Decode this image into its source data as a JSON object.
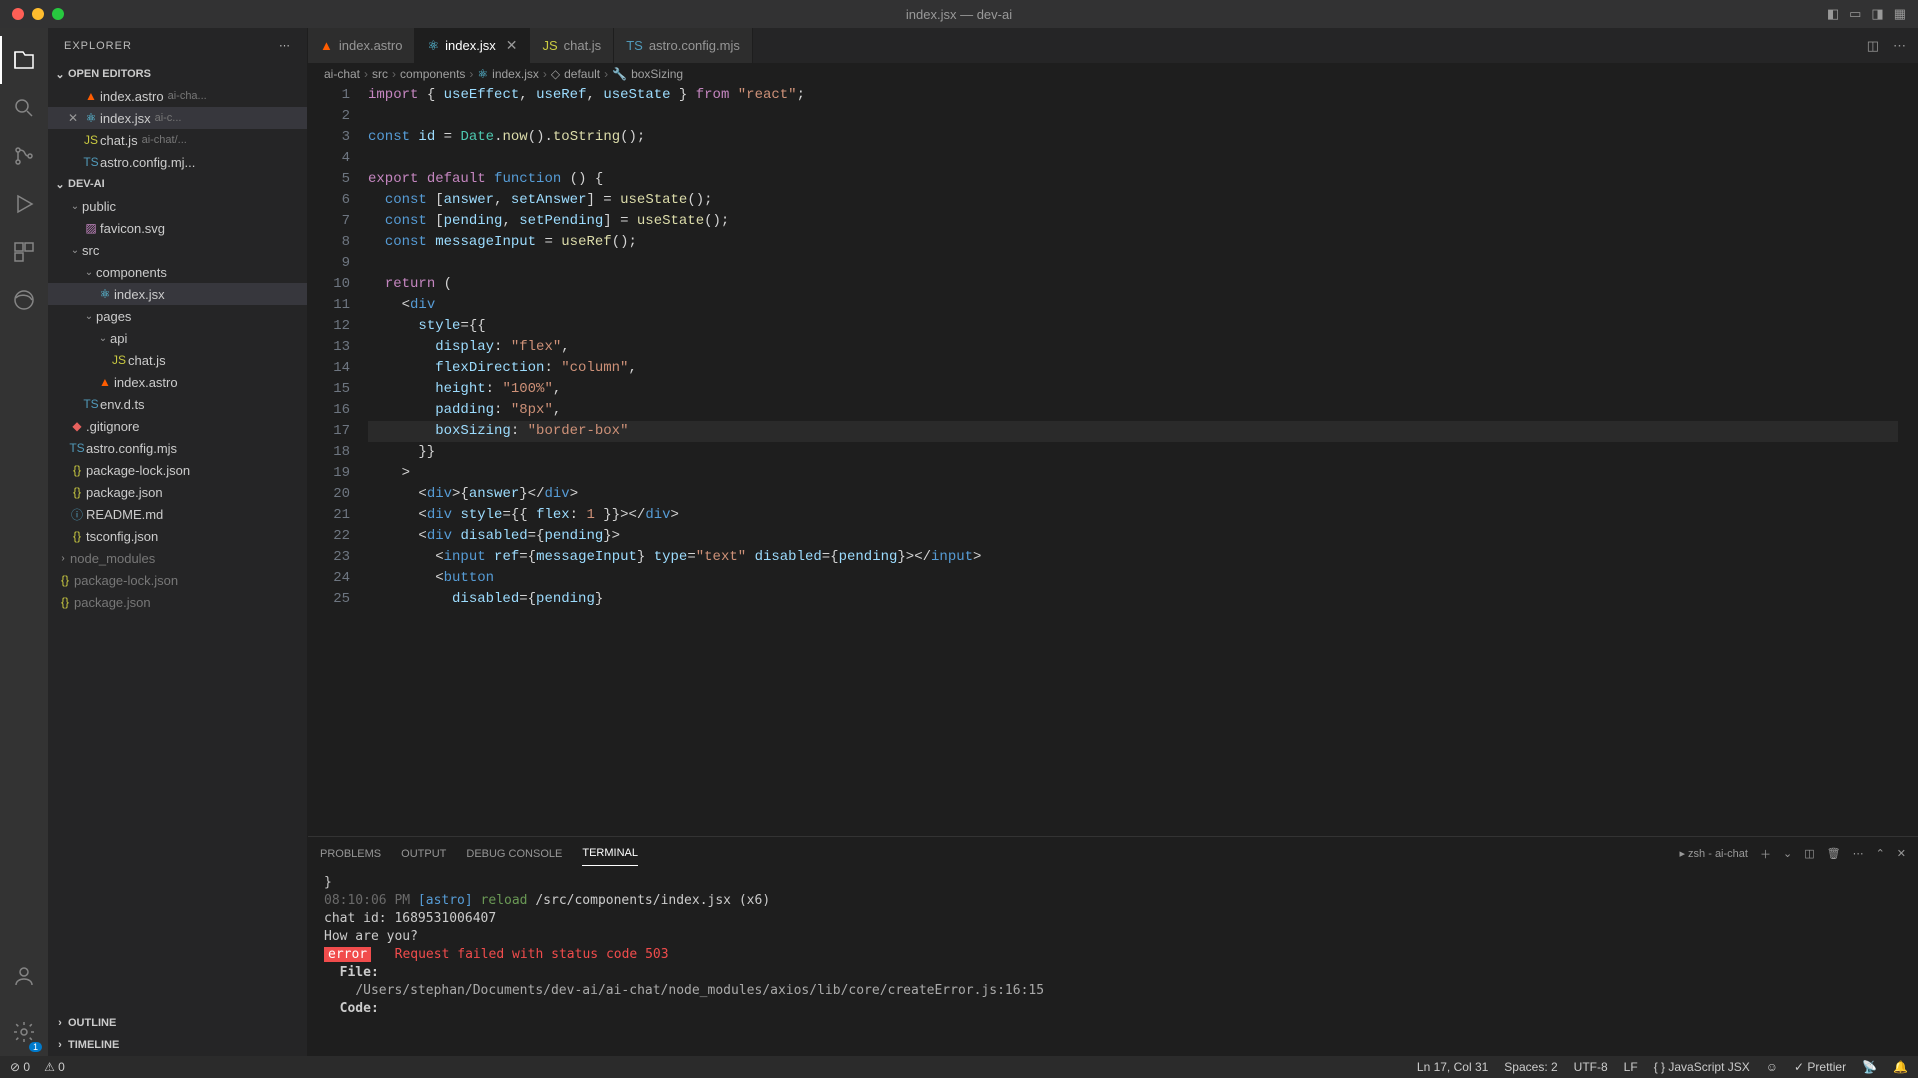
{
  "window": {
    "title": "index.jsx — dev-ai"
  },
  "sidebar": {
    "title": "EXPLORER",
    "sections": {
      "openEditors": "OPEN EDITORS",
      "project": "DEV-AI",
      "outline": "OUTLINE",
      "timeline": "TIMELINE"
    },
    "openEditors": [
      {
        "name": "index.astro",
        "meta": "ai-cha..."
      },
      {
        "name": "index.jsx",
        "meta": "ai-c...",
        "active": true
      },
      {
        "name": "chat.js",
        "meta": "ai-chat/..."
      },
      {
        "name": "astro.config.mj...",
        "meta": ""
      }
    ],
    "tree": {
      "public": "public",
      "favicon": "favicon.svg",
      "src": "src",
      "components": "components",
      "indexjsx": "index.jsx",
      "pages": "pages",
      "api": "api",
      "chatjs": "chat.js",
      "indexastro": "index.astro",
      "envdts": "env.d.ts",
      "gitignore": ".gitignore",
      "astroconfig": "astro.config.mjs",
      "pkglock": "package-lock.json",
      "pkg": "package.json",
      "readme": "README.md",
      "tsconfig": "tsconfig.json",
      "nodemodules": "node_modules",
      "pkglock2": "package-lock.json",
      "pkg2": "package.json"
    }
  },
  "tabs": [
    {
      "label": "index.astro",
      "icon": "astro"
    },
    {
      "label": "index.jsx",
      "icon": "react",
      "active": true,
      "close": true
    },
    {
      "label": "chat.js",
      "icon": "js"
    },
    {
      "label": "astro.config.mjs",
      "icon": "ts"
    }
  ],
  "breadcrumbs": [
    "ai-chat",
    "src",
    "components",
    "index.jsx",
    "default",
    "boxSizing"
  ],
  "code": {
    "lines": [
      {
        "n": 1,
        "html": "<span class='tok-kw'>import</span> { <span class='tok-var'>useEffect</span>, <span class='tok-var'>useRef</span>, <span class='tok-var'>useState</span> } <span class='tok-kw'>from</span> <span class='tok-str'>\"react\"</span>;"
      },
      {
        "n": 2,
        "html": ""
      },
      {
        "n": 3,
        "html": "<span class='tok-const'>const</span> <span class='tok-var'>id</span> = <span class='tok-type'>Date</span>.<span class='tok-fn'>now</span>().<span class='tok-fn'>toString</span>();"
      },
      {
        "n": 4,
        "html": ""
      },
      {
        "n": 5,
        "html": "<span class='tok-kw'>export</span> <span class='tok-kw'>default</span> <span class='tok-const'>function</span> () {"
      },
      {
        "n": 6,
        "html": "  <span class='tok-const'>const</span> [<span class='tok-var'>answer</span>, <span class='tok-var'>setAnswer</span>] = <span class='tok-fn'>useState</span>();"
      },
      {
        "n": 7,
        "html": "  <span class='tok-const'>const</span> [<span class='tok-var'>pending</span>, <span class='tok-var'>setPending</span>] = <span class='tok-fn'>useState</span>();"
      },
      {
        "n": 8,
        "html": "  <span class='tok-const'>const</span> <span class='tok-var'>messageInput</span> = <span class='tok-fn'>useRef</span>();"
      },
      {
        "n": 9,
        "html": ""
      },
      {
        "n": 10,
        "html": "  <span class='tok-kw'>return</span> ("
      },
      {
        "n": 11,
        "html": "    &lt;<span class='tok-tag'>div</span>"
      },
      {
        "n": 12,
        "html": "      <span class='tok-attr'>style</span>={{"
      },
      {
        "n": 13,
        "html": "        <span class='tok-var'>display</span>: <span class='tok-str'>\"flex\"</span>,"
      },
      {
        "n": 14,
        "html": "        <span class='tok-var'>flexDirection</span>: <span class='tok-str'>\"column\"</span>,"
      },
      {
        "n": 15,
        "html": "        <span class='tok-var'>height</span>: <span class='tok-str'>\"100%\"</span>,"
      },
      {
        "n": 16,
        "html": "        <span class='tok-var'>padding</span>: <span class='tok-str'>\"8px\"</span>,"
      },
      {
        "n": 17,
        "html": "        <span class='tok-var'>boxSizing</span>: <span class='tok-str'>\"border-box\"</span>",
        "hl": true
      },
      {
        "n": 18,
        "html": "      }}"
      },
      {
        "n": 19,
        "html": "    &gt;"
      },
      {
        "n": 20,
        "html": "      &lt;<span class='tok-tag'>div</span>&gt;{<span class='tok-var'>answer</span>}&lt;/<span class='tok-tag'>div</span>&gt;"
      },
      {
        "n": 21,
        "html": "      &lt;<span class='tok-tag'>div</span> <span class='tok-attr'>style</span>={{ <span class='tok-var'>flex</span>: <span class='tok-str'>1</span> }}&gt;&lt;/<span class='tok-tag'>div</span>&gt;"
      },
      {
        "n": 22,
        "html": "      &lt;<span class='tok-tag'>div</span> <span class='tok-attr'>disabled</span>={<span class='tok-var'>pending</span>}&gt;"
      },
      {
        "n": 23,
        "html": "        &lt;<span class='tok-tag'>input</span> <span class='tok-attr'>ref</span>={<span class='tok-var'>messageInput</span>} <span class='tok-attr'>type</span>=<span class='tok-str'>\"text\"</span> <span class='tok-attr'>disabled</span>={<span class='tok-var'>pending</span>}&gt;&lt;/<span class='tok-tag'>input</span>&gt;"
      },
      {
        "n": 24,
        "html": "        &lt;<span class='tok-tag'>button</span>"
      },
      {
        "n": 25,
        "html": "          <span class='tok-attr'>disabled</span>={<span class='tok-var'>pending</span>}"
      }
    ]
  },
  "panel": {
    "tabs": [
      "PROBLEMS",
      "OUTPUT",
      "DEBUG CONSOLE",
      "TERMINAL"
    ],
    "activeTab": 3,
    "shellLabel": "zsh - ai-chat",
    "terminal": {
      "brace": "  }",
      "time": "08:10:06 PM",
      "astro": "[astro]",
      "reload": "reload",
      "reloadPath": "/src/components/index.jsx (x6)",
      "chatId": "chat id: 1689531006407",
      "question": "How are you?",
      "errorTag": "error",
      "errorMsg": "Request failed with status code 503",
      "fileLabel": "File:",
      "filePath": "/Users/stephan/Documents/dev-ai/ai-chat/node_modules/axios/lib/core/createError.js:16:15",
      "codeLabel": "Code:"
    }
  },
  "statusbar": {
    "errors": "0",
    "warnings": "0",
    "cursor": "Ln 17, Col 31",
    "spaces": "Spaces: 2",
    "encoding": "UTF-8",
    "eol": "LF",
    "language": "JavaScript JSX",
    "prettier": "Prettier"
  }
}
